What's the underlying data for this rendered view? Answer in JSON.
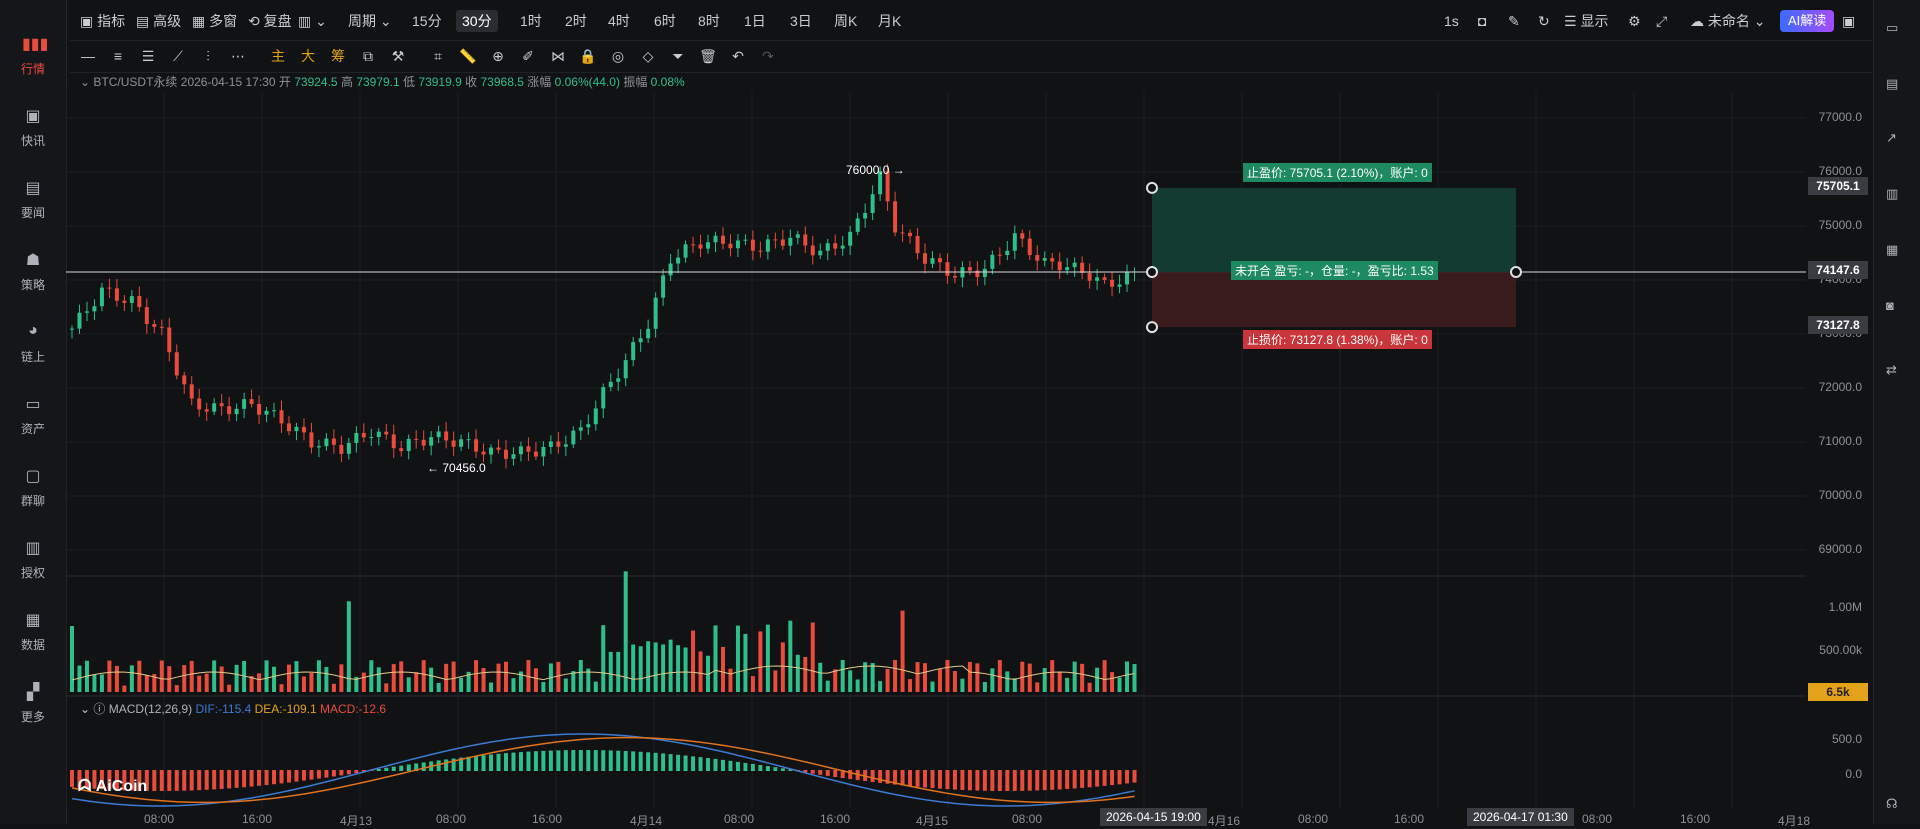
{
  "nav": {
    "items": [
      {
        "label": "行情",
        "icon": "market-bars-icon"
      },
      {
        "label": "快讯",
        "icon": "news-flash-icon"
      },
      {
        "label": "要闻",
        "icon": "headline-doc-icon"
      },
      {
        "label": "策略",
        "icon": "robot-icon"
      },
      {
        "label": "链上",
        "icon": "chain-icon"
      },
      {
        "label": "资产",
        "icon": "wallet-icon"
      },
      {
        "label": "群聊",
        "icon": "chat-icon"
      },
      {
        "label": "授权",
        "icon": "key-icon"
      },
      {
        "label": "数据",
        "icon": "monitor-chart-icon"
      },
      {
        "label": "更多",
        "icon": "grid-icon"
      }
    ]
  },
  "topbar": {
    "indicator": "指标",
    "advanced": "高级",
    "multi_window": "多窗",
    "replay": "复盘",
    "period": "周期",
    "periods": [
      "15分",
      "30分",
      "1时",
      "2时",
      "4时",
      "6时",
      "8时",
      "1日",
      "3日",
      "周K",
      "月K"
    ],
    "active_period": "30分",
    "interval": "1s",
    "display": "显示",
    "unnamed": "未命名",
    "ai": "AI解读"
  },
  "toolbar": {
    "main": "主",
    "big": "大",
    "chips": "筹"
  },
  "info": {
    "symbol": "BTC/USDT永续",
    "datetime": "2026-04-15 17:30",
    "open_label": "开",
    "open": "73924.5",
    "high_label": "高",
    "high": "73979.1",
    "low_label": "低",
    "low": "73919.9",
    "close_label": "收",
    "close": "73968.5",
    "change_label": "涨幅",
    "change": "0.06%(44.0)",
    "amp_label": "振幅",
    "amp": "0.08%"
  },
  "price_axis": [
    "77000.0",
    "76000.0",
    "75000.0",
    "74000.0",
    "73000.0",
    "72000.0",
    "71000.0",
    "70000.0",
    "69000.0"
  ],
  "markers": {
    "high_mark": "76000.0",
    "low_mark": "70456.0"
  },
  "position": {
    "take_profit": "止盈价: 75705.1 (2.10%)，账户: 0",
    "open_info": "未开合 盈亏: -，仓量: -，盈亏比: 1.53",
    "stop_loss": "止损价: 73127.8 (1.38%)，账户: 0",
    "tp_price": "75705.1",
    "current_price": "74147.6",
    "sl_price": "73127.8"
  },
  "volume_axis": [
    "1.00M",
    "500.00k"
  ],
  "volume_box": "6.5k",
  "macd": {
    "title": "MACD(12,26,9)",
    "dif": "DIF:-115.4",
    "dea": "DEA:-109.1",
    "macd": "MACD:-12.6",
    "axis": [
      "500.0",
      "0.0"
    ]
  },
  "time_axis": [
    "08:00",
    "16:00",
    "4月13",
    "08:00",
    "16:00",
    "4月14",
    "08:00",
    "16:00",
    "4月15",
    "08:00",
    "16:00",
    "4月16",
    "08:00",
    "16:00",
    "08:00",
    "16:00",
    "4月18"
  ],
  "time_box_1": "2026-04-15 19:00",
  "time_box_2": "2026-04-17 01:30",
  "logo_text": "AiCoin",
  "colors": {
    "up": "#2fbf8a",
    "down": "#e84c3d",
    "accent": "#e3a21a"
  }
}
